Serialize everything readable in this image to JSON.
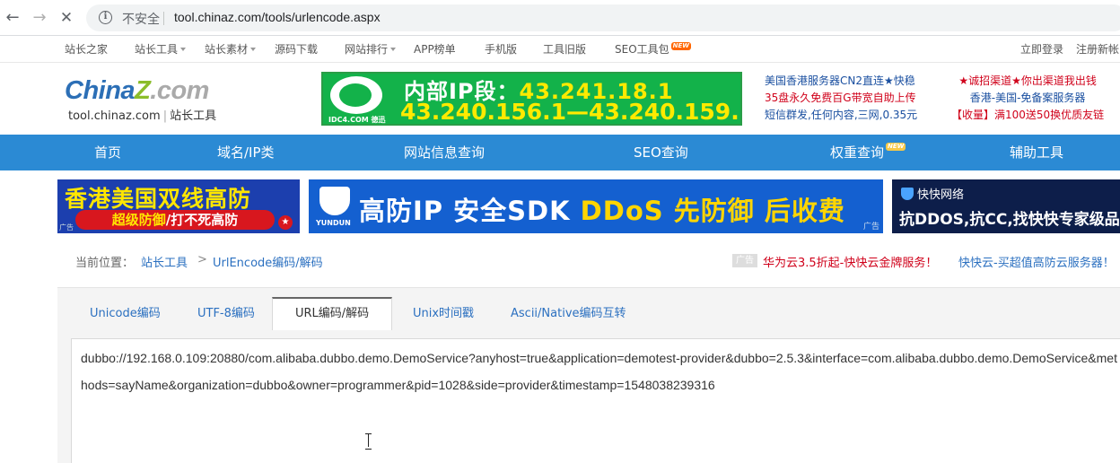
{
  "browser": {
    "back_icon": "arrow-left-icon",
    "forward_icon": "arrow-right-icon",
    "stop_icon": "close-icon",
    "security_label": "不安全",
    "url": "tool.chinaz.com/tools/urlencode.aspx"
  },
  "toplinks": {
    "items": [
      "站长之家",
      "站长工具",
      "站长素材",
      "源码下载",
      "网站排行",
      "APP榜单",
      "手机版",
      "工具旧版",
      "SEO工具包"
    ],
    "new_badge": "NEW",
    "login": "立即登录",
    "register": "注册新帐"
  },
  "header": {
    "logo_china": "China",
    "logo_z": "Z",
    "logo_com": ".com",
    "logo_domain": "tool.chinaz.com",
    "logo_sep": "|",
    "logo_tagline": "站长工具",
    "banner_brand": "IDC4.COM 德迅",
    "banner_line1_label": "内部IP段：",
    "banner_line1_ip": "43.241.18.1",
    "banner_line2": "43.240.156.1—43.240.159.1",
    "ad_a": [
      "美国香港服务器CN2直连★快稳",
      "35盘永久免费百G带宽自助上传",
      "短信群发,任何内容,三网,0.35元"
    ],
    "ad_b": [
      "★诚招渠道★你出渠道我出钱",
      "香港-美国-免备案服务器",
      "【收量】满100送50换优质友链"
    ]
  },
  "mainnav": {
    "items": [
      "首页",
      "域名/IP类",
      "网站信息查询",
      "SEO查询",
      "权重查询",
      "辅助工具"
    ],
    "new_badge": "NEW"
  },
  "ads": {
    "ad1_title": "香港美国双线高防",
    "ad1_sub_a": "超级防御",
    "ad1_sub_b": "/打不死高防",
    "ad1_tag": "广告",
    "ad2_brand": "YUNDUN",
    "ad2_text_a": "高防IP 安全SDK ",
    "ad2_text_b": "DDoS 先防御 后收费",
    "ad2_tag": "广告",
    "ad3_head": "快快网络",
    "ad3_text": "抗DDOS,抗CC,找快快专家级品牌"
  },
  "breadcrumb": {
    "label": "当前位置：",
    "home": "站长工具",
    "sep": ">",
    "current": "UrlEncode编码/解码",
    "ad_box": "广告",
    "ad_a": "华为云3.5折起-快快云金牌服务！",
    "ad_b": "快快云-买超值高防云服务器！"
  },
  "tabs": [
    "Unicode编码",
    "UTF-8编码",
    "URL编码/解码",
    "Unix时间戳",
    "Ascii/Native编码互转"
  ],
  "active_tab": "URL编码/解码",
  "input": {
    "value": "dubbo://192.168.0.109:20880/com.alibaba.dubbo.demo.DemoService?anyhost=true&application=demotest-provider&dubbo=2.5.3&interface=com.alibaba.dubbo.demo.DemoService&methods=sayName&organization=dubbo&owner=programmer&pid=1028&side=provider&timestamp=1548038239316"
  }
}
